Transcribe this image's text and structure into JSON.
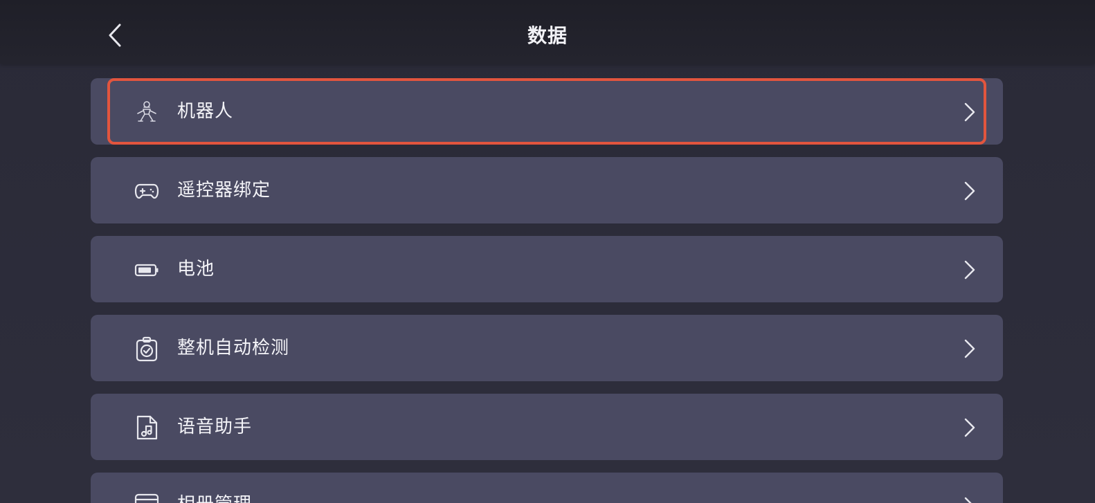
{
  "header": {
    "title": "数据",
    "back_icon": "chevron-left-icon"
  },
  "colors": {
    "background": "#2c2c3a",
    "card": "#4a4a62",
    "selection": "#e2553e",
    "text": "#f4f4f8"
  },
  "menu": {
    "items": [
      {
        "label": "机器人",
        "icon": "robot-icon",
        "selected": true
      },
      {
        "label": "遥控器绑定",
        "icon": "gamepad-icon",
        "selected": false
      },
      {
        "label": "电池",
        "icon": "battery-icon",
        "selected": false
      },
      {
        "label": "整机自动检测",
        "icon": "clipboard-check-icon",
        "selected": false
      },
      {
        "label": "语音助手",
        "icon": "music-file-icon",
        "selected": false
      },
      {
        "label": "相册管理",
        "icon": "album-icon",
        "selected": false
      }
    ]
  }
}
